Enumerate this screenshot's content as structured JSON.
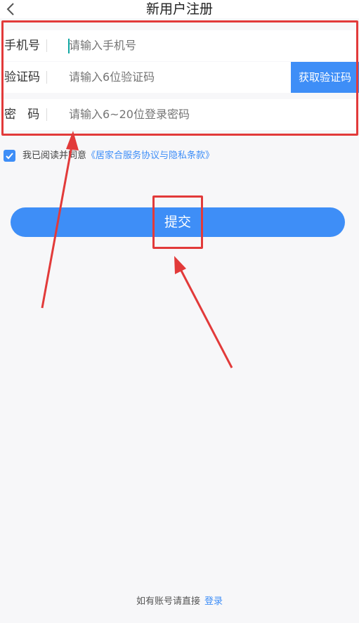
{
  "header": {
    "title": "新用户注册",
    "back_icon": "chevron-left-icon"
  },
  "form": {
    "phone": {
      "label": "手机号",
      "placeholder": "请输入手机号"
    },
    "code": {
      "label": "验证码",
      "placeholder": "请输入6位验证码",
      "button_label": "获取验证码"
    },
    "password": {
      "label": "密   码",
      "placeholder": "请输入6~20位登录密码"
    }
  },
  "agreement": {
    "checked": true,
    "text": "我已阅读并同意",
    "link": "《居家合服务协议与隐私条款》"
  },
  "submit": {
    "label": "提交"
  },
  "footer": {
    "prompt": "如有账号请直接",
    "login_label": "登录"
  },
  "colors": {
    "accent": "#3e8ef7",
    "annotation": "#e23a3a",
    "background": "#f7f7f9"
  }
}
